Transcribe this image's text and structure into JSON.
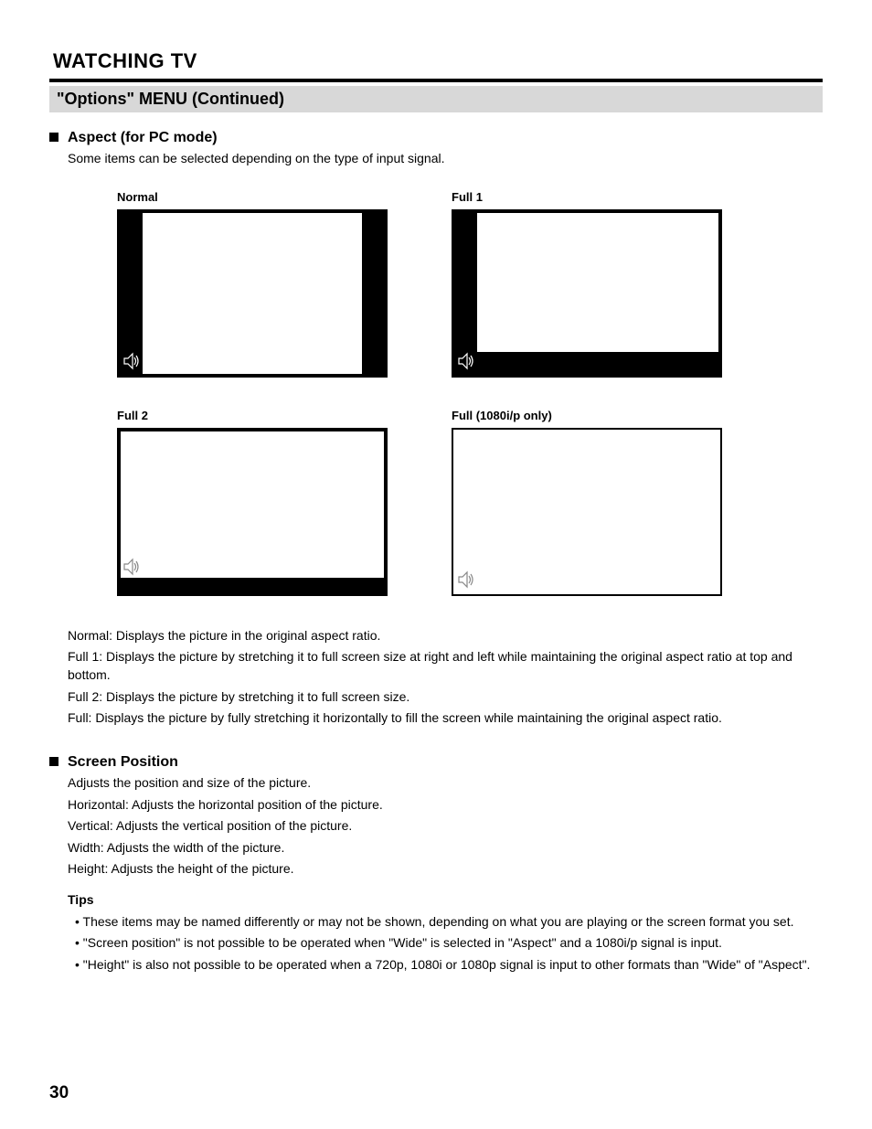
{
  "header": {
    "section_title": "WATCHING TV",
    "menu_title": "\"Options\" MENU (Continued)"
  },
  "aspect": {
    "heading": "Aspect (for PC mode)",
    "intro": "Some items can be selected depending on the type of input signal.",
    "items": [
      {
        "caption": "Normal",
        "mode": "normal"
      },
      {
        "caption": "Full 1",
        "mode": "full1"
      },
      {
        "caption": "Full 2",
        "mode": "full2"
      },
      {
        "caption": "Full (1080i/p only)",
        "mode": "full_wide"
      }
    ],
    "notes": [
      "Normal: Displays the picture in the original aspect ratio.",
      "Full 1: Displays the picture by stretching it to full screen size at right and left while maintaining the original aspect ratio at top and bottom.",
      "Full 2: Displays the picture by stretching it to full screen size.",
      "Full: Displays the picture by fully stretching it horizontally to fill the screen while maintaining the original aspect ratio."
    ]
  },
  "screen_position": {
    "heading": "Screen Position",
    "intro": "Adjusts the position and size of the picture.",
    "horizontal": "Horizontal: Adjusts the horizontal position of the picture.",
    "vertical": "Vertical: Adjusts the vertical position of the picture.",
    "width": "Width: Adjusts the width of the picture.",
    "height": "Height: Adjusts the height of the picture.",
    "tips_label": "Tips",
    "tips": [
      "These items may be named differently or may not be shown, depending on what you are playing or the screen format you set.",
      "\"Screen position\" is not possible to be operated when \"Wide\" is selected in \"Aspect\" and a 1080i/p signal is input.",
      "\"Height\" is also not possible to be operated when a 720p, 1080i or 1080p signal is input to other formats than \"Wide\" of \"Aspect\"."
    ]
  },
  "footer": {
    "page_number": "30"
  }
}
